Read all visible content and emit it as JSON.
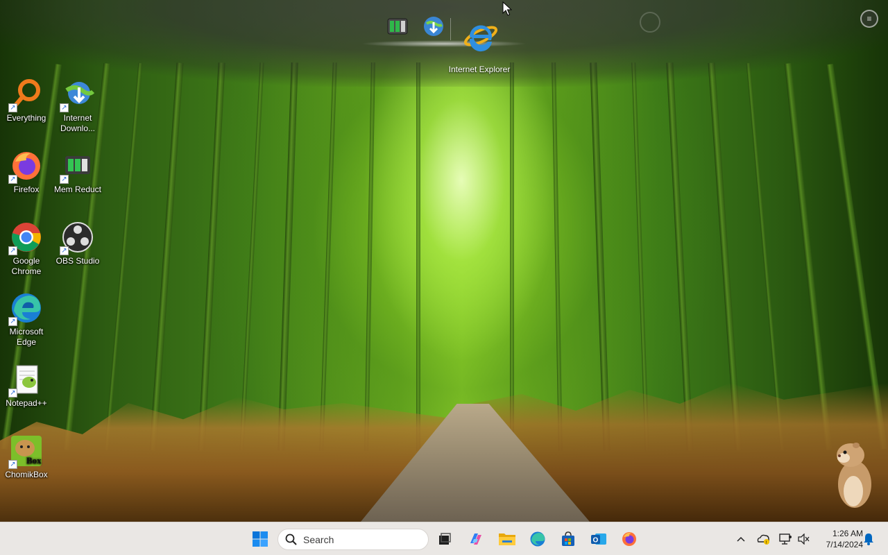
{
  "dock": {
    "items": [
      {
        "name": "Mem Reduct"
      },
      {
        "name": "Internet Download Manager"
      },
      {
        "name": "Internet Explorer",
        "label": "Internet Explorer"
      }
    ]
  },
  "desktop_icons": [
    {
      "id": "everything",
      "label": "Everything"
    },
    {
      "id": "internet-download-manager",
      "label": "Internet Downlo..."
    },
    {
      "id": "firefox",
      "label": "Firefox"
    },
    {
      "id": "mem-reduct",
      "label": "Mem Reduct"
    },
    {
      "id": "google-chrome",
      "label": "Google Chrome"
    },
    {
      "id": "obs-studio",
      "label": "OBS Studio"
    },
    {
      "id": "microsoft-edge",
      "label": "Microsoft Edge"
    },
    {
      "id": "notepadpp",
      "label": "Notepad++"
    },
    {
      "id": "chomikbox",
      "label": "ChomikBox"
    }
  ],
  "taskbar": {
    "search_placeholder": "Search",
    "pinned": [
      "start",
      "task-view",
      "copilot",
      "file-explorer",
      "edge",
      "microsoft-store",
      "outlook",
      "firefox"
    ],
    "tray": {
      "time": "1:26 AM",
      "date": "7/14/2024"
    }
  },
  "colors": {
    "taskbar_bg": "#eae7e4",
    "accent_blue": "#0067c0"
  }
}
